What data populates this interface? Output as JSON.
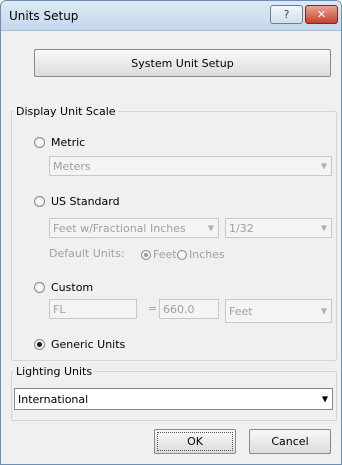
{
  "window": {
    "title": "Units Setup",
    "help_glyph": "?",
    "close_glyph": "✕"
  },
  "system_unit_setup_label": "System Unit Setup",
  "display_unit_scale": {
    "label": "Display Unit Scale",
    "metric": {
      "label": "Metric",
      "selected": false,
      "value": "Meters"
    },
    "us_standard": {
      "label": "US Standard",
      "selected": false,
      "value": "Feet w/Fractional Inches",
      "fraction": "1/32",
      "default_units_label": "Default Units:",
      "feet_label": "Feet",
      "inches_label": "Inches",
      "default_units_selected": "Feet"
    },
    "custom": {
      "label": "Custom",
      "selected": false,
      "name": "FL",
      "equals": "=",
      "amount": "660.0",
      "unit": "Feet"
    },
    "generic": {
      "label": "Generic Units",
      "selected": true
    }
  },
  "lighting_units": {
    "label": "Lighting Units",
    "value": "International"
  },
  "buttons": {
    "ok": "OK",
    "cancel": "Cancel"
  },
  "icons": {
    "dropdown": "▼"
  }
}
